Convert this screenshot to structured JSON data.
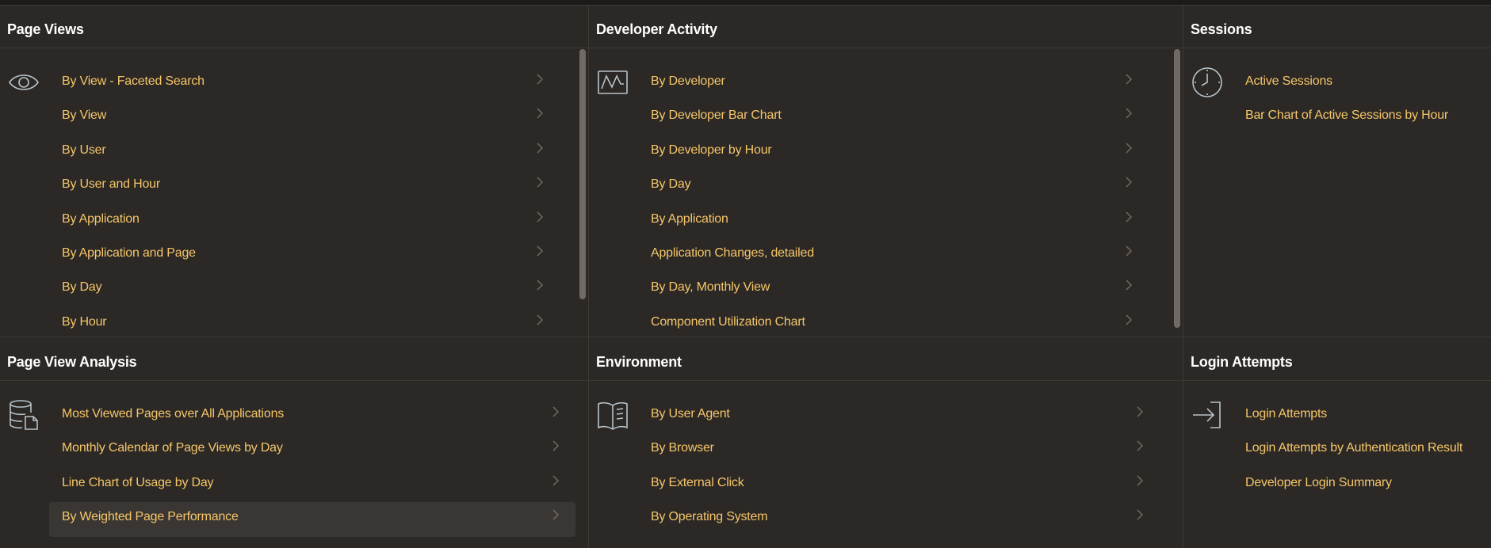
{
  "panels": {
    "page_views": {
      "title": "Page Views",
      "icon": "eye-icon",
      "items": [
        "By View - Faceted Search",
        "By View",
        "By User",
        "By User and Hour",
        "By Application",
        "By Application and Page",
        "By Day",
        "By Hour"
      ]
    },
    "developer_activity": {
      "title": "Developer Activity",
      "icon": "activity-chart-icon",
      "items": [
        "By Developer",
        "By Developer Bar Chart",
        "By Developer by Hour",
        "By Day",
        "By Application",
        "Application Changes, detailed",
        "By Day, Monthly View",
        "Component Utilization Chart"
      ]
    },
    "sessions": {
      "title": "Sessions",
      "icon": "clock-icon",
      "items": [
        "Active Sessions",
        "Bar Chart of Active Sessions by Hour"
      ]
    },
    "page_view_analysis": {
      "title": "Page View Analysis",
      "icon": "database-document-icon",
      "items": [
        "Most Viewed Pages over All Applications",
        "Monthly Calendar of Page Views by Day",
        "Line Chart of Usage by Day",
        "By Weighted Page Performance"
      ]
    },
    "environment": {
      "title": "Environment",
      "icon": "open-book-icon",
      "items": [
        "By User Agent",
        "By Browser",
        "By External Click",
        "By Operating System"
      ]
    },
    "login_attempts": {
      "title": "Login Attempts",
      "icon": "sign-in-icon",
      "items": [
        "Login Attempts",
        "Login Attempts by Authentication Result",
        "Developer Login Summary"
      ]
    }
  },
  "colors": {
    "background": "#2b2825",
    "link": "#f5c66a",
    "title": "#ffffff",
    "chevron": "#6f6a65",
    "icon": "#b7c3c9"
  }
}
